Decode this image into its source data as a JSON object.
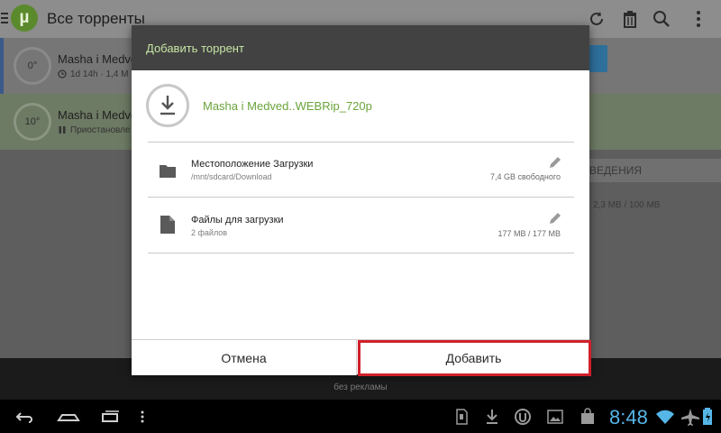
{
  "app": {
    "title": "Все торренты",
    "logo_letter": "µ",
    "toolbar_icons": [
      "refresh-icon",
      "trash-icon",
      "search-icon",
      "overflow-menu-icon"
    ]
  },
  "torrent_list": [
    {
      "name": "Masha i Medve",
      "progress_label": "0°",
      "meta": "1d 14h · 1,4 M",
      "status_icon": "clock-icon"
    },
    {
      "name": "Masha i Medve",
      "progress_label": "10°",
      "meta": "Приостановле",
      "status_icon": "pause-icon"
    }
  ],
  "side_panel": {
    "tab_label": "ВЕДЕНИЯ",
    "size": "2,3 MB / 100 MB"
  },
  "banner": {
    "text": "без рекламы"
  },
  "dialog": {
    "title": "Добавить торрент",
    "torrent_name": "Masha i Medved..WEBRip_720p",
    "options": [
      {
        "title": "Местоположение Загрузки",
        "subtitle": "/mnt/sdcard/Download",
        "value": "7,4 GB свободного",
        "icon": "folder-icon"
      },
      {
        "title": "Файлы для загрузки",
        "subtitle": "2 файлов",
        "value": "177 MB / 177 MB",
        "icon": "file-icon"
      }
    ],
    "cancel_label": "Отмена",
    "add_label": "Добавить"
  },
  "status_bar": {
    "time": "8:48",
    "clock_color": "#56b6e8"
  },
  "colors": {
    "accent_green": "#6aa33a",
    "header_dark": "#424242",
    "highlight_red": "#d0202a"
  }
}
